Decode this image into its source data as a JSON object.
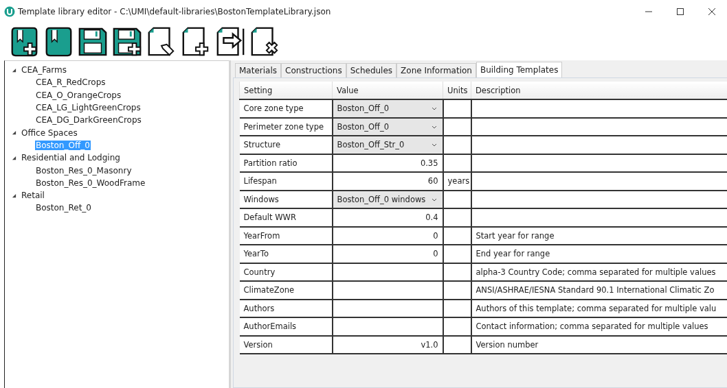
{
  "window": {
    "title": "Template library editor - C:\\UMI\\default-libraries\\BostonTemplateLibrary.json"
  },
  "toolbar": [
    {
      "kind": "book-add"
    },
    {
      "kind": "book"
    },
    {
      "kind": "save"
    },
    {
      "kind": "save-add"
    },
    {
      "kind": "doc-tag"
    },
    {
      "kind": "doc-add"
    },
    {
      "kind": "doc-export"
    },
    {
      "kind": "doc-delete"
    }
  ],
  "tree": [
    {
      "label": "CEA_Farms",
      "expanded": true,
      "selected": false,
      "children": [
        {
          "label": "CEA_R_RedCrops",
          "selected": false
        },
        {
          "label": "CEA_O_OrangeCrops",
          "selected": false
        },
        {
          "label": "CEA_LG_LightGreenCrops",
          "selected": false
        },
        {
          "label": "CEA_DG_DarkGreenCrops",
          "selected": false
        }
      ]
    },
    {
      "label": "Office Spaces",
      "expanded": true,
      "selected": false,
      "children": [
        {
          "label": "Boston_Off_0",
          "selected": true
        }
      ]
    },
    {
      "label": "Residential and Lodging",
      "expanded": true,
      "selected": false,
      "children": [
        {
          "label": "Boston_Res_0_Masonry",
          "selected": false
        },
        {
          "label": "Boston_Res_0_WoodFrame",
          "selected": false
        }
      ]
    },
    {
      "label": "Retail",
      "expanded": true,
      "selected": false,
      "children": [
        {
          "label": "Boston_Ret_0",
          "selected": false
        }
      ]
    }
  ],
  "tabs": [
    {
      "label": "Materials",
      "selected": false
    },
    {
      "label": "Constructions",
      "selected": false
    },
    {
      "label": "Schedules",
      "selected": false
    },
    {
      "label": "Zone Information",
      "selected": false
    },
    {
      "label": "Building Templates",
      "selected": true
    }
  ],
  "table": {
    "columns": [
      "Setting",
      "Value",
      "Units",
      "Description"
    ],
    "rows": [
      {
        "setting": "Core zone type",
        "kind": "dropdown",
        "value": "Boston_Off_0"
      },
      {
        "setting": "Perimeter zone type",
        "kind": "dropdown",
        "value": "Boston_Off_0"
      },
      {
        "setting": "Structure",
        "kind": "dropdown",
        "value": "Boston_Off_Str_0"
      },
      {
        "setting": "Partition ratio",
        "kind": "number",
        "value": "0.35"
      },
      {
        "setting": "Lifespan",
        "kind": "number",
        "value": "60",
        "units": "years"
      },
      {
        "setting": "Windows",
        "kind": "dropdown",
        "value": "Boston_Off_0 windows"
      },
      {
        "setting": "Default WWR",
        "kind": "number",
        "value": "0.4"
      },
      {
        "setting": "YearFrom",
        "kind": "number",
        "value": "0",
        "description": "Start year for range"
      },
      {
        "setting": "YearTo",
        "kind": "number",
        "value": "0",
        "description": "End year for range"
      },
      {
        "setting": "Country",
        "kind": "number",
        "description": "alpha-3 Country Code; comma separated for multiple values"
      },
      {
        "setting": "ClimateZone",
        "kind": "number",
        "description": "ANSI/ASHRAE/IESNA Standard 90.1 International Climatic Zo"
      },
      {
        "setting": "Authors",
        "kind": "number",
        "description": "Authors of this template; comma separated for multiple valu"
      },
      {
        "setting": "AuthorEmails",
        "kind": "number",
        "description": "Contact information; comma separated for multiple values"
      },
      {
        "setting": "Version",
        "kind": "number",
        "value": "v1.0",
        "description": "Version number"
      }
    ]
  }
}
